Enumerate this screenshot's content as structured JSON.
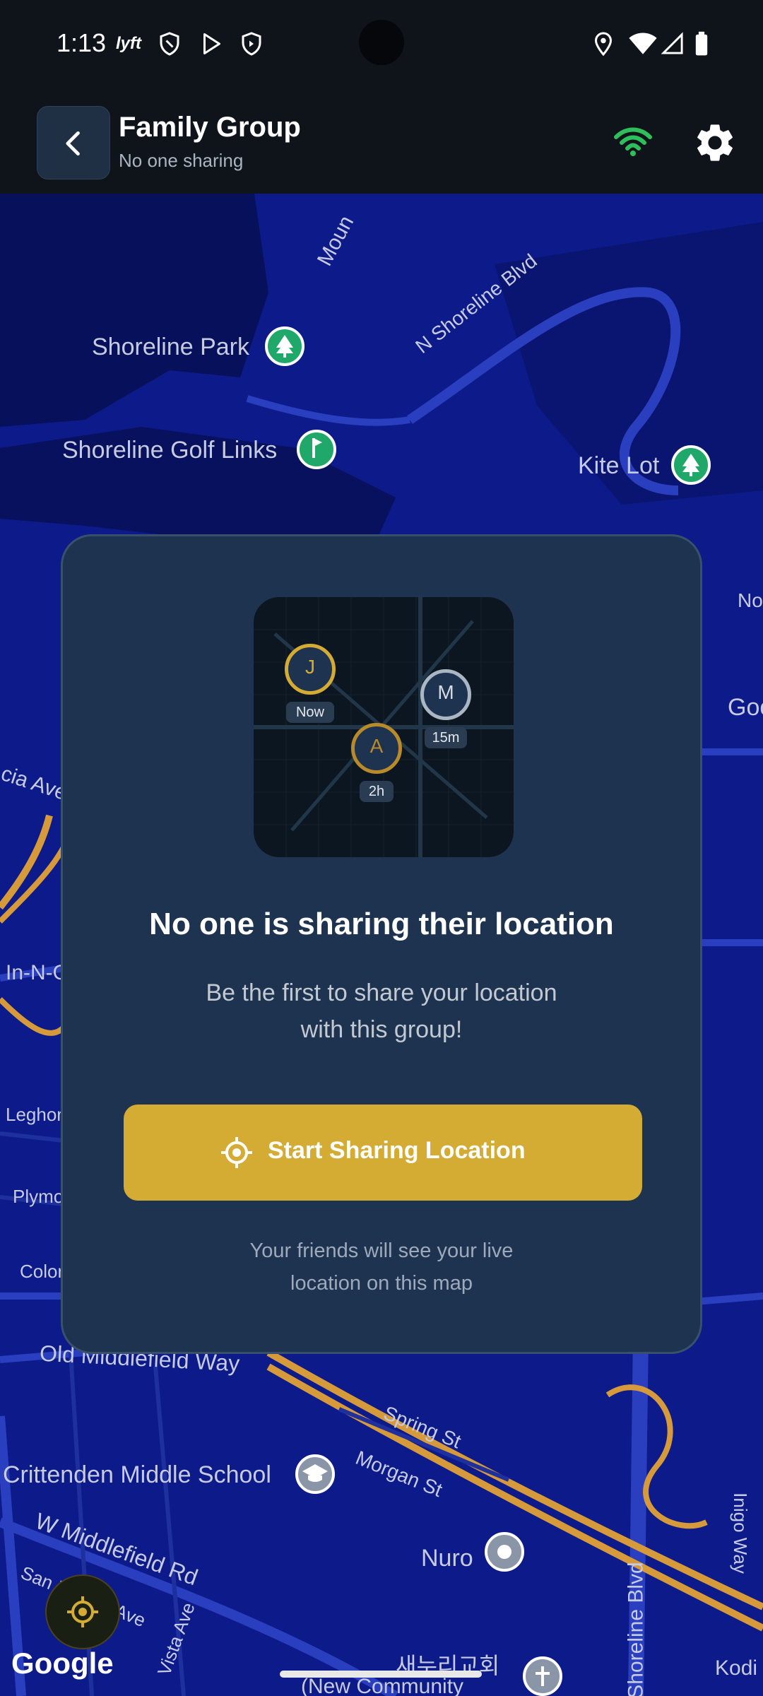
{
  "status_bar": {
    "time": "1:13",
    "app_icon_label": "lyft"
  },
  "header": {
    "title": "Family Group",
    "subtitle": "No one sharing"
  },
  "map": {
    "labels": {
      "mountain": "Moun",
      "shoreline_blvd_n": "N Shoreline Blvd",
      "shoreline_park": "Shoreline Park",
      "shoreline_golf": "Shoreline Golf Links",
      "kite_lot": "Kite Lot",
      "edge_no": "No",
      "edge_goo": "Goo",
      "edge_ave": "cia Ave",
      "edge_in_n_out": "In-N-Out Burger",
      "edge_leghorn": "Leghor",
      "edge_plymouth": "Plymouth",
      "edge_colony": "Colon",
      "old_middlefield": "Old Middlefield Way",
      "spring_st": "Spring St",
      "morgan_st": "Morgan St",
      "crittenden": "Crittenden Middle School",
      "w_middlefield": "W Middlefield Rd",
      "nuro": "Nuro",
      "shoreline_blvd": "Shoreline Blvd",
      "korean_church": "새누리교회",
      "korean_church_en": "(New Community",
      "inigo_way": "Inigo Way",
      "kodi": "Kodi",
      "san_ramon": "San Ramon Ave",
      "vista_ave": "Vista Ave"
    },
    "google": "Google"
  },
  "card": {
    "avatars": [
      {
        "letter": "J",
        "time": "Now"
      },
      {
        "letter": "M",
        "time": "15m"
      },
      {
        "letter": "A",
        "time": "2h"
      }
    ],
    "title": "No one is sharing their location",
    "subtitle_line1": "Be the first to share your location",
    "subtitle_line2": "with this group!",
    "cta_label": "Start Sharing Location",
    "footer_line1": "Your friends will see your live",
    "footer_line2": "location on this map"
  },
  "colors": {
    "accent": "#d4ac34",
    "map_bg": "#0d1a8a",
    "card_bg": "#1e3350",
    "park_pin": "#1fa86a",
    "wifi_green": "#2fbf5a"
  }
}
